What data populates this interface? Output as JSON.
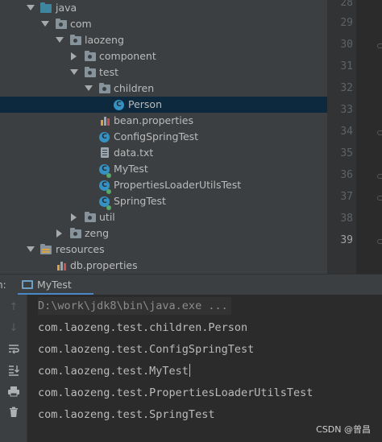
{
  "project_tree": {
    "items": [
      {
        "label": "java",
        "icon": "source-folder-icon",
        "expanded": true
      },
      {
        "label": "com",
        "icon": "package-icon",
        "expanded": true
      },
      {
        "label": "laozeng",
        "icon": "package-icon",
        "expanded": true
      },
      {
        "label": "component",
        "icon": "package-icon",
        "expanded": false
      },
      {
        "label": "test",
        "icon": "package-icon",
        "expanded": true
      },
      {
        "label": "children",
        "icon": "package-icon",
        "expanded": true
      },
      {
        "label": "Person",
        "icon": "class-icon",
        "selected": true
      },
      {
        "label": "bean.properties",
        "icon": "properties-file-icon"
      },
      {
        "label": "ConfigSpringTest",
        "icon": "test-class-icon"
      },
      {
        "label": "data.txt",
        "icon": "text-file-icon"
      },
      {
        "label": "MyTest",
        "icon": "test-class-icon"
      },
      {
        "label": "PropertiesLoaderUtilsTest",
        "icon": "test-class-icon"
      },
      {
        "label": "SpringTest",
        "icon": "test-class-icon"
      },
      {
        "label": "util",
        "icon": "package-icon",
        "expanded": false
      },
      {
        "label": "zeng",
        "icon": "package-icon",
        "expanded": false
      },
      {
        "label": "resources",
        "icon": "resources-folder-icon",
        "expanded": true
      },
      {
        "label": "db.properties",
        "icon": "properties-file-icon"
      }
    ]
  },
  "editor": {
    "line_numbers": [
      "28",
      "29",
      "30",
      "31",
      "32",
      "33",
      "34",
      "35",
      "36",
      "37",
      "38",
      "39"
    ],
    "current_line": "39"
  },
  "run_panel": {
    "prefix": "n:",
    "tab_label": "MyTest",
    "accent_color": "#4a88c7",
    "toolbar": [
      "up-arrow-icon",
      "down-arrow-icon",
      "soft-wrap-icon",
      "scroll-to-end-icon",
      "print-icon",
      "trash-icon"
    ],
    "console_lines": [
      "D:\\work\\jdk8\\bin\\java.exe ...",
      "com.laozeng.test.children.Person",
      "com.laozeng.test.ConfigSpringTest",
      "com.laozeng.test.MyTest",
      "com.laozeng.test.PropertiesLoaderUtilsTest",
      "com.laozeng.test.SpringTest"
    ]
  },
  "watermark": "CSDN @曾昌"
}
